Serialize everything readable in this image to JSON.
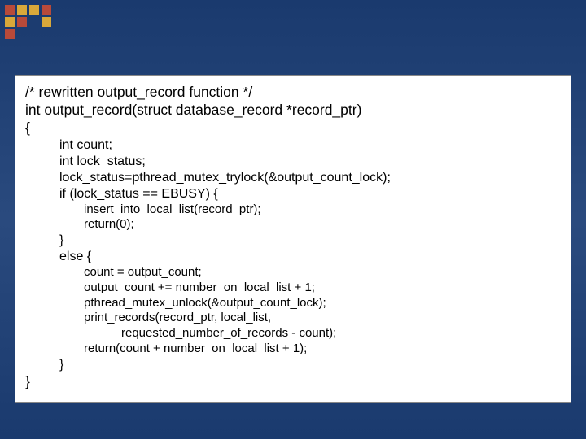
{
  "code": {
    "c1": "/* rewritten output_record function */",
    "c2": "int output_record(struct database_record *record_ptr)",
    "c3": "{",
    "c4": "int count;",
    "c5": "int lock_status;",
    "c6": "lock_status=pthread_mutex_trylock(&output_count_lock);",
    "c7": "if (lock_status == EBUSY) {",
    "c8": "insert_into_local_list(record_ptr);",
    "c9": "return(0);",
    "c10": "}",
    "c11": "else {",
    "c12": "count = output_count;",
    "c13": "output_count += number_on_local_list + 1;",
    "c14": "pthread_mutex_unlock(&output_count_lock);",
    "c15": "print_records(record_ptr, local_list,",
    "c16": "requested_number_of_records - count);",
    "c17": "return(count + number_on_local_list + 1);",
    "c18": "}",
    "c19": "}"
  }
}
